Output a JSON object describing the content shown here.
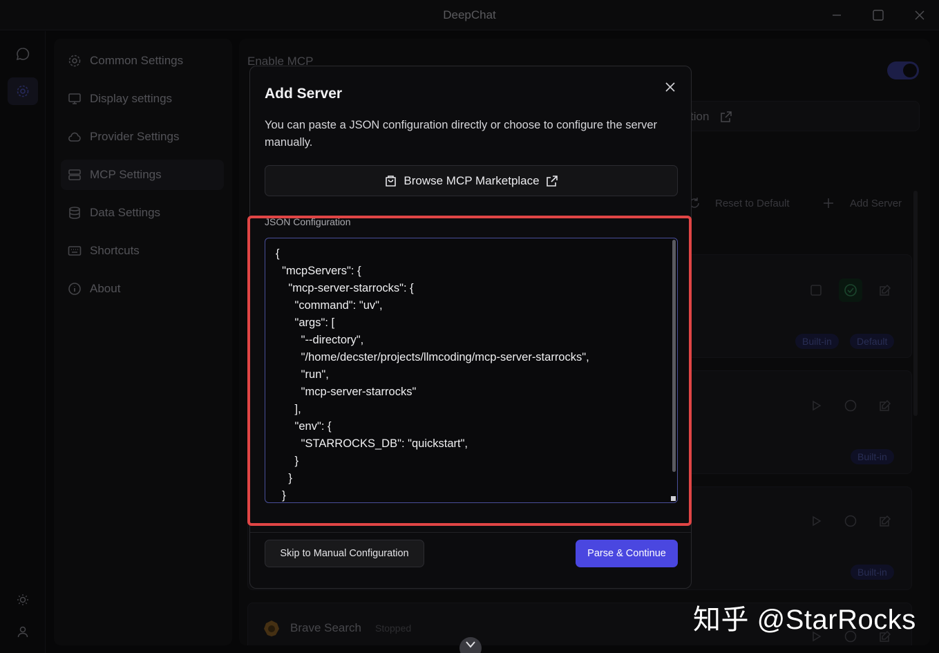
{
  "window": {
    "title": "DeepChat"
  },
  "sidebar": {
    "items": [
      {
        "label": "Common Settings",
        "icon": "gear-icon"
      },
      {
        "label": "Display settings",
        "icon": "monitor-icon"
      },
      {
        "label": "Provider Settings",
        "icon": "cloud-icon"
      },
      {
        "label": "MCP Settings",
        "icon": "server-icon",
        "active": true
      },
      {
        "label": "Data Settings",
        "icon": "database-icon"
      },
      {
        "label": "Shortcuts",
        "icon": "keyboard-icon"
      },
      {
        "label": "About",
        "icon": "info-icon"
      }
    ]
  },
  "background": {
    "enable_mcp_label": "Enable MCP",
    "link_fragment": "tion",
    "reset_label": "Reset to Default",
    "add_server_label": "Add Server",
    "badges": {
      "builtin": "Built-in",
      "default": "Default"
    },
    "brave_search": {
      "name": "Brave Search",
      "status": "Stopped"
    }
  },
  "modal": {
    "title": "Add Server",
    "description": "You can paste a JSON configuration directly or choose to configure the server manually.",
    "marketplace_label": "Browse MCP Marketplace",
    "json_label": "JSON Configuration",
    "json_lines": [
      "{",
      "  \"mcpServers\": {",
      "    \"mcp-server-starrocks\": {",
      "      \"command\": \"uv\",",
      "      \"args\": [",
      "        \"--directory\",",
      "        \"/home/decster/projects/llmcoding/mcp-server-starrocks\",",
      "        \"run\",",
      "        \"mcp-server-starrocks\"",
      "      ],",
      "      \"env\": {",
      "        \"STARROCKS_DB\": \"quickstart\",",
      "      }",
      "    }",
      "  }"
    ],
    "skip_label": "Skip to Manual Configuration",
    "parse_label": "Parse & Continue"
  },
  "watermark": "知乎 @StarRocks",
  "colors": {
    "accent": "#4a47e0",
    "highlight": "#e04545"
  }
}
